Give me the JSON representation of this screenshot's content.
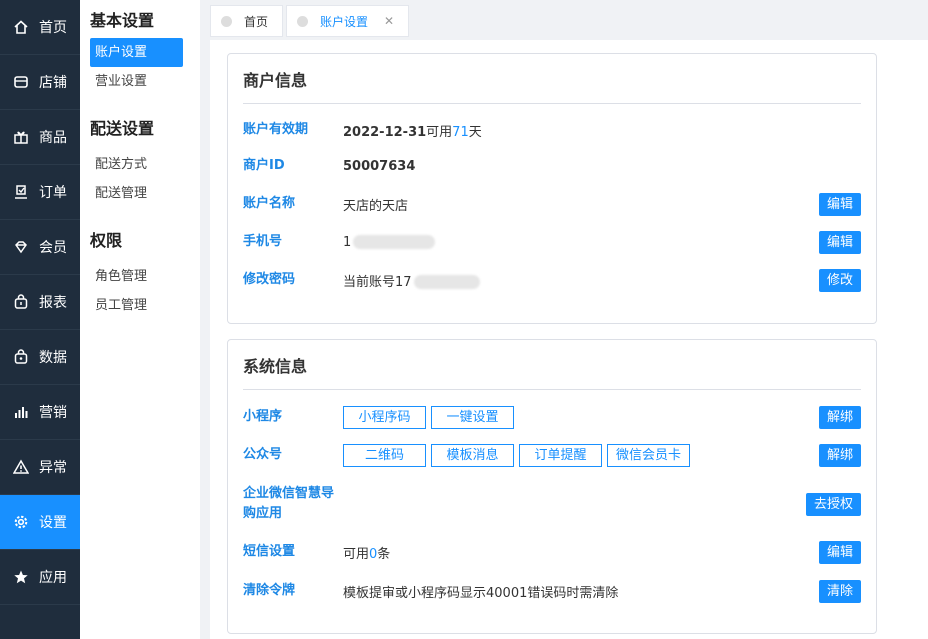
{
  "nav": {
    "items": [
      {
        "icon": "home-icon",
        "label": "首页"
      },
      {
        "icon": "store-icon",
        "label": "店铺"
      },
      {
        "icon": "gift-icon",
        "label": "商品"
      },
      {
        "icon": "order-icon",
        "label": "订单"
      },
      {
        "icon": "diamond-icon",
        "label": "会员"
      },
      {
        "icon": "report-icon",
        "label": "报表"
      },
      {
        "icon": "data-icon",
        "label": "数据"
      },
      {
        "icon": "bar-chart-icon",
        "label": "营销"
      },
      {
        "icon": "warning-icon",
        "label": "异常"
      },
      {
        "icon": "gear-icon",
        "label": "设置"
      },
      {
        "icon": "star-icon",
        "label": "应用"
      }
    ],
    "active_index": 9,
    "colors": {
      "bg": "#1f2d3d",
      "active": "#1890ff"
    }
  },
  "submenu": {
    "groups": [
      {
        "title": "基本设置",
        "items": [
          "账户设置",
          "营业设置"
        ]
      },
      {
        "title": "配送设置",
        "items": [
          "配送方式",
          "配送管理"
        ]
      },
      {
        "title": "权限",
        "items": [
          "角色管理",
          "员工管理"
        ]
      }
    ],
    "active": "账户设置"
  },
  "tabs": [
    {
      "label": "首页",
      "closable": false,
      "active": false
    },
    {
      "label": "账户设置",
      "closable": true,
      "active": true
    }
  ],
  "merchant_card": {
    "title": "商户信息",
    "rows": {
      "validity": {
        "label": "账户有效期",
        "date": "2022-12-31",
        "available_prefix": "可用",
        "days": "71",
        "days_suffix": "天"
      },
      "merchant_id": {
        "label": "商户ID",
        "value": "50007634"
      },
      "account_name": {
        "label": "账户名称",
        "value": "天店的天店",
        "button": "编辑"
      },
      "phone": {
        "label": "手机号",
        "value_prefix": "1",
        "button": "编辑"
      },
      "password": {
        "label": "修改密码",
        "value_prefix": "当前账号17",
        "button": "修改"
      }
    }
  },
  "system_card": {
    "title": "系统信息",
    "rows": {
      "mini_program": {
        "label": "小程序",
        "buttons": [
          "小程序码",
          "一键设置"
        ],
        "action": "解绑"
      },
      "official_account": {
        "label": "公众号",
        "buttons": [
          "二维码",
          "模板消息",
          "订单提醒",
          "微信会员卡"
        ],
        "action": "解绑"
      },
      "wecom": {
        "label_line1": "企业微信智慧导",
        "label_line2": "购应用",
        "action": "去授权"
      },
      "sms": {
        "label": "短信设置",
        "value_prefix": "可用",
        "count": "0",
        "value_suffix": "条",
        "action": "编辑"
      },
      "token": {
        "label": "清除令牌",
        "value": "模板提审或小程序码显示40001错误码时需清除",
        "action": "清除"
      }
    }
  },
  "accent_color": "#1890ff"
}
